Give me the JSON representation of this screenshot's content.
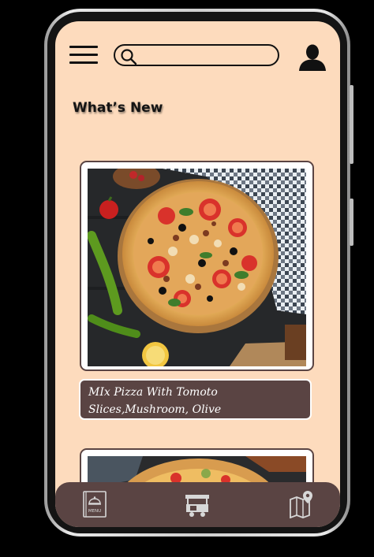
{
  "header": {
    "search_placeholder": "",
    "menu_icon": "hamburger-menu-icon",
    "search_icon": "search-icon",
    "profile_icon": "user-icon"
  },
  "section": {
    "title": "What’s New"
  },
  "products": [
    {
      "name": "MIx Pizza With Tomoto Slices,Mushroom, Olive",
      "image": "pizza-photo"
    },
    {
      "name": "",
      "image": "pizza-photo"
    }
  ],
  "tabbar": {
    "items": [
      {
        "icon": "menu-book-icon",
        "label": "MENU"
      },
      {
        "icon": "food-cart-icon"
      },
      {
        "icon": "map-location-icon"
      }
    ]
  },
  "colors": {
    "background": "#fddbbd",
    "accent": "#5a4443",
    "text": "#141414"
  }
}
